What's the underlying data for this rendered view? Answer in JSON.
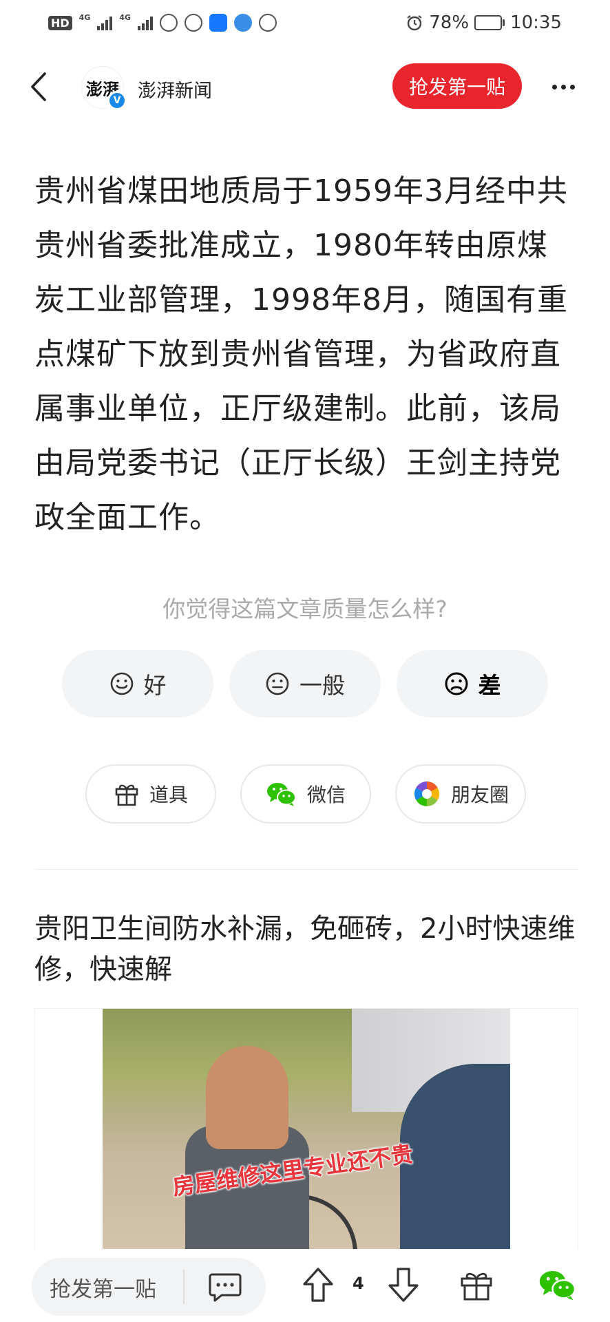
{
  "status_bar": {
    "hd_label": "HD",
    "network_label_1": "4G",
    "network_label_2": "4G",
    "battery_percent": "78%",
    "battery_level": 0.78,
    "time": "10:35"
  },
  "header": {
    "logo_text": "澎湃",
    "verified_mark": "V",
    "source_name": "澎湃新闻",
    "grab_first_label": "抢发第一贴"
  },
  "article": {
    "body": "贵州省煤田地质局于1959年3月经中共贵州省委批准成立，1980年转由原煤炭工业部管理，1998年8月，随国有重点煤矿下放到贵州省管理，为省政府直属事业单位，正厅级建制。此前，该局由局党委书记（正厅长级）王剑主持党政全面工作。"
  },
  "rating": {
    "prompt": "你觉得这篇文章质量怎么样?",
    "good_label": "好",
    "average_label": "一般",
    "bad_label": "差"
  },
  "share": {
    "props_label": "道具",
    "wechat_label": "微信",
    "moments_label": "朋友圈"
  },
  "ad": {
    "title": "贵阳卫生间防水补漏，免砸砖，2小时快速维修，快速解",
    "image_caption": "房屋维修这里专业还不贵"
  },
  "bottom_bar": {
    "comment_placeholder": "抢发第一贴",
    "vote_count": "4"
  },
  "colors": {
    "accent_red": "#e8242c",
    "verified_blue": "#1a88e6",
    "wechat_green": "#2dc100"
  }
}
